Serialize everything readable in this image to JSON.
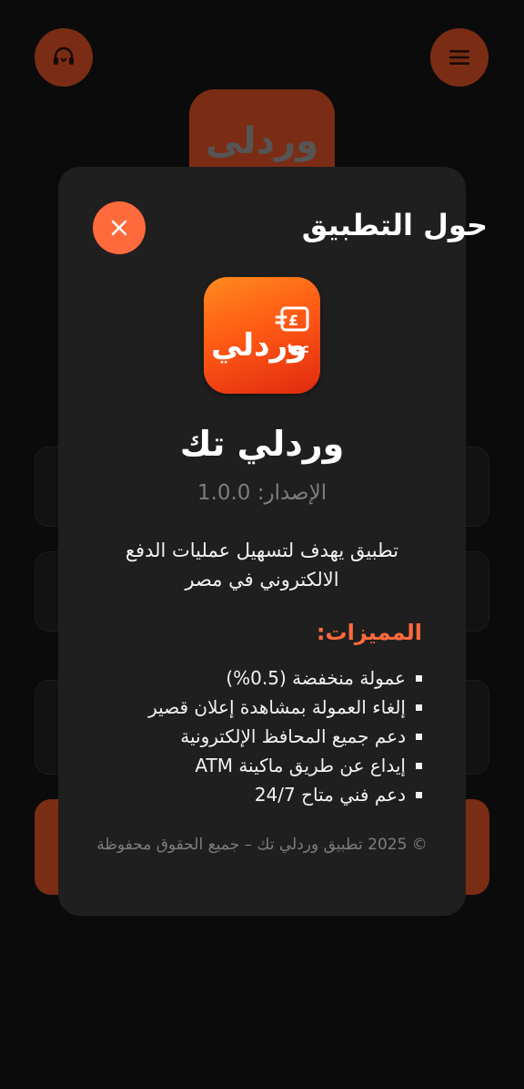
{
  "background": {
    "logo_text": "وردلى"
  },
  "modal": {
    "title": "حول التطبيق",
    "app_icon": {
      "brand_text": "وردلي",
      "sub_text": "tec"
    },
    "app_name": "وردلي تك",
    "version": "الإصدار: 1.0.0",
    "description": "تطبيق يهدف لتسهيل عمليات الدفع الالكتروني في مصر",
    "features_title": "المميزات:",
    "features": [
      "عمولة منخفضة (0.5%)",
      "إلغاء العمولة بمشاهدة إعلان قصير",
      "دعم جميع المحافظ الإلكترونية",
      "إيداع عن طريق ماكينة ATM",
      "دعم فني متاح 24/7"
    ],
    "copyright": "© 2025 تطبيق وردلي تك – جميع الحقوق محفوظة"
  },
  "icons": {
    "support": "headset-icon",
    "menu": "hamburger-menu-icon",
    "close": "close-icon",
    "app_card": "wallet-card-icon"
  },
  "colors": {
    "accent": "#ff6a3d",
    "accent_dim": "#7a2d14",
    "modal_bg": "#1f1f1f",
    "page_bg": "#0b0b0b",
    "muted_text": "#7d7d7d"
  }
}
